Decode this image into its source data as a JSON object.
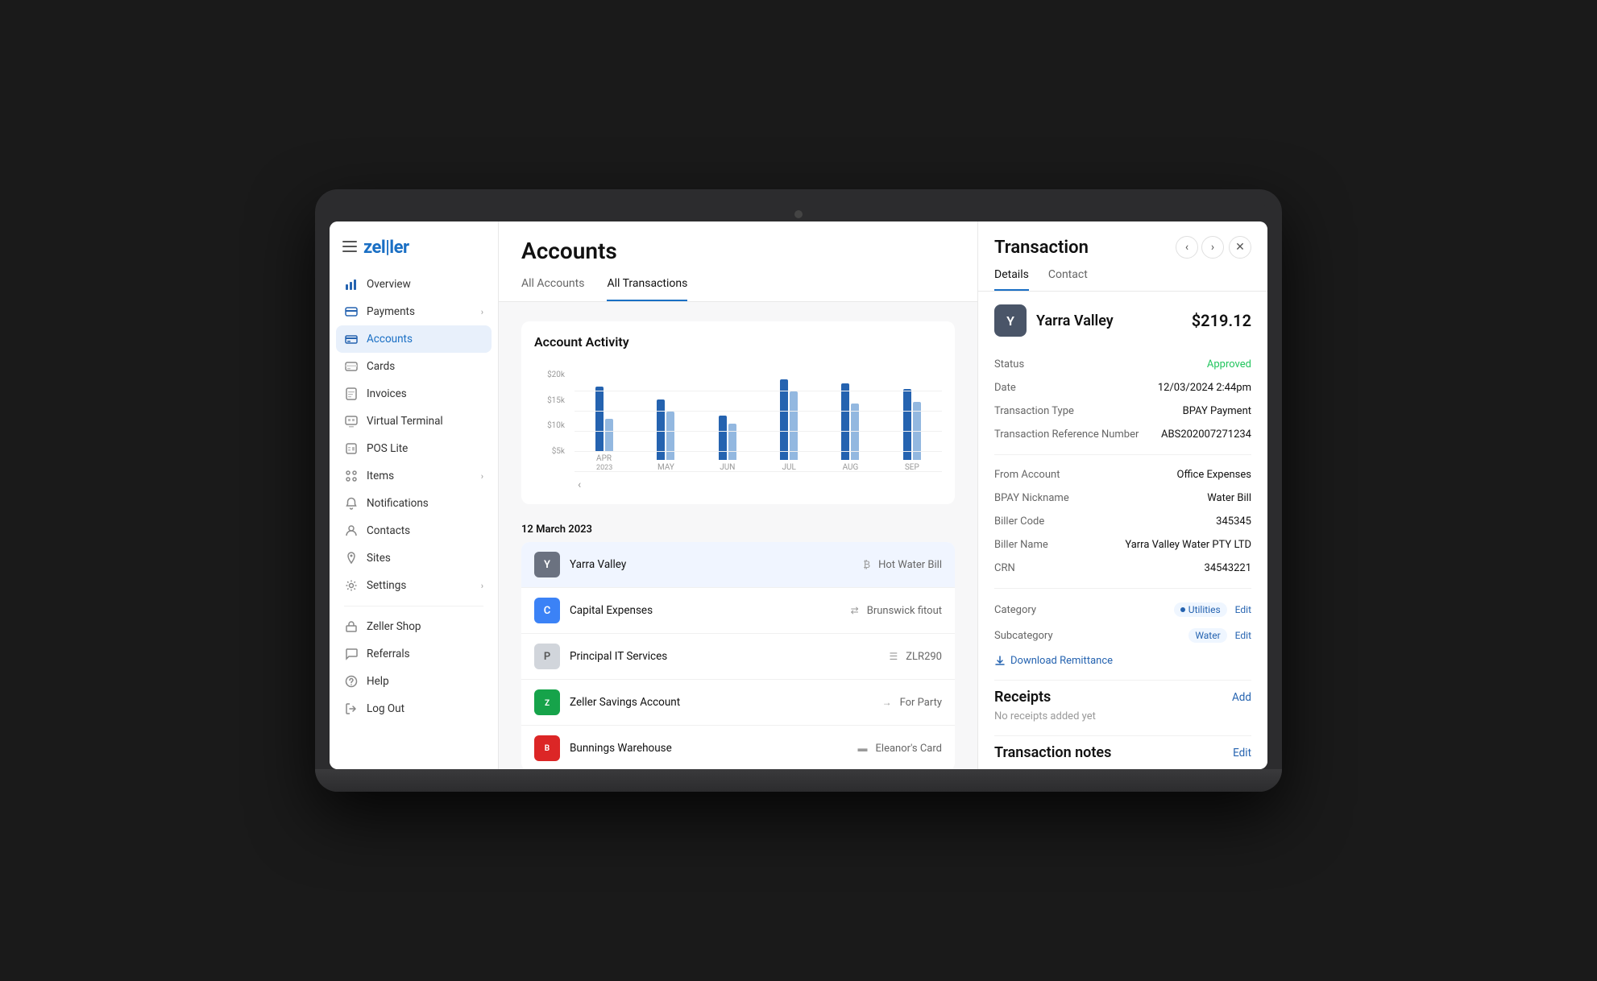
{
  "app": {
    "logo": "zeller"
  },
  "sidebar": {
    "menu_icon": "≡",
    "items": [
      {
        "id": "overview",
        "label": "Overview",
        "icon": "bar-chart",
        "active": false,
        "has_chevron": false
      },
      {
        "id": "payments",
        "label": "Payments",
        "icon": "credit-card",
        "active": false,
        "has_chevron": true
      },
      {
        "id": "accounts",
        "label": "Accounts",
        "icon": "bank",
        "active": true,
        "has_chevron": false
      },
      {
        "id": "cards",
        "label": "Cards",
        "icon": "card",
        "active": false,
        "has_chevron": false
      },
      {
        "id": "invoices",
        "label": "Invoices",
        "icon": "invoice",
        "active": false,
        "has_chevron": false
      },
      {
        "id": "virtual-terminal",
        "label": "Virtual Terminal",
        "icon": "terminal",
        "active": false,
        "has_chevron": false
      },
      {
        "id": "pos-lite",
        "label": "POS Lite",
        "icon": "pos",
        "active": false,
        "has_chevron": false
      },
      {
        "id": "items",
        "label": "Items",
        "icon": "items",
        "active": false,
        "has_chevron": true
      },
      {
        "id": "notifications",
        "label": "Notifications",
        "icon": "bell",
        "active": false,
        "has_chevron": false
      },
      {
        "id": "contacts",
        "label": "Contacts",
        "icon": "person",
        "active": false,
        "has_chevron": false
      },
      {
        "id": "sites",
        "label": "Sites",
        "icon": "location",
        "active": false,
        "has_chevron": false
      },
      {
        "id": "settings",
        "label": "Settings",
        "icon": "gear",
        "active": false,
        "has_chevron": true
      }
    ],
    "bottom_items": [
      {
        "id": "zeller-shop",
        "label": "Zeller Shop",
        "icon": "shop"
      },
      {
        "id": "referrals",
        "label": "Referrals",
        "icon": "chat"
      },
      {
        "id": "help",
        "label": "Help",
        "icon": "help"
      },
      {
        "id": "logout",
        "label": "Log Out",
        "icon": "logout"
      }
    ]
  },
  "main": {
    "title": "Accounts",
    "tabs": [
      {
        "id": "all-accounts",
        "label": "All Accounts",
        "active": false
      },
      {
        "id": "all-transactions",
        "label": "All Transactions",
        "active": true
      }
    ],
    "chart": {
      "title": "Account Activity",
      "y_labels": [
        "$20k",
        "$15k",
        "$10k",
        "$5k",
        ""
      ],
      "months": [
        {
          "label": "APR\n2023",
          "bar1": 80,
          "bar2": 40
        },
        {
          "label": "MAY",
          "bar1": 75,
          "bar2": 60
        },
        {
          "label": "JUN",
          "bar1": 55,
          "bar2": 45
        },
        {
          "label": "JUL",
          "bar1": 100,
          "bar2": 85
        },
        {
          "label": "AUG",
          "bar1": 95,
          "bar2": 70
        },
        {
          "label": "SEP",
          "bar1": 88,
          "bar2": 72
        }
      ]
    },
    "date_label": "12 March 2023",
    "transactions": [
      {
        "id": "tx1",
        "name": "Yarra Valley",
        "avatar_letter": "Y",
        "avatar_bg": "#6b7280",
        "type_icon": "₿",
        "description": "Hot Water Bill",
        "selected": true
      },
      {
        "id": "tx2",
        "name": "Capital Expenses",
        "avatar_letter": "C",
        "avatar_bg": "#3b82f6",
        "type_icon": "⇄",
        "description": "Brunswick fitout",
        "selected": false
      },
      {
        "id": "tx3",
        "name": "Principal IT Services",
        "avatar_letter": "P",
        "avatar_bg": "#d1d5db",
        "avatar_color": "#555",
        "type_icon": "☰",
        "description": "ZLR290",
        "selected": false
      },
      {
        "id": "tx4",
        "name": "Zeller Savings Account",
        "avatar_letter": "Z",
        "avatar_bg": "#16a34a",
        "type_icon": "→",
        "description": "For Party",
        "selected": false
      },
      {
        "id": "tx5",
        "name": "Bunnings Warehouse",
        "avatar_letter": "B",
        "avatar_bg": "#dc2626",
        "type_icon": "▬",
        "description": "Eleanor's Card",
        "selected": false
      }
    ]
  },
  "detail": {
    "title": "Transaction",
    "tabs": [
      {
        "id": "details",
        "label": "Details",
        "active": true
      },
      {
        "id": "contact",
        "label": "Contact",
        "active": false
      }
    ],
    "merchant": {
      "avatar_letter": "Y",
      "avatar_bg": "#4a5568",
      "name": "Yarra Valley",
      "amount": "$219.12"
    },
    "fields": [
      {
        "label": "Status",
        "value": "Approved",
        "type": "approved"
      },
      {
        "label": "Date",
        "value": "12/03/2024 2:44pm",
        "type": "normal"
      },
      {
        "label": "Transaction Type",
        "value": "BPAY Payment",
        "type": "normal"
      },
      {
        "label": "Transaction Reference Number",
        "value": "ABS202007271234",
        "type": "normal"
      }
    ],
    "fields2": [
      {
        "label": "From Account",
        "value": "Office Expenses",
        "type": "normal"
      },
      {
        "label": "BPAY Nickname",
        "value": "Water Bill",
        "type": "normal"
      },
      {
        "label": "Biller Code",
        "value": "345345",
        "type": "normal"
      },
      {
        "label": "Biller Name",
        "value": "Yarra Valley Water PTY LTD",
        "type": "normal"
      },
      {
        "label": "CRN",
        "value": "34543221",
        "type": "normal"
      }
    ],
    "category": {
      "label": "Category",
      "tag": "Utilities",
      "edit_label": "Edit"
    },
    "subcategory": {
      "label": "Subcategory",
      "tag": "Water",
      "edit_label": "Edit"
    },
    "download_remittance_label": "Download Remittance",
    "receipts": {
      "title": "Receipts",
      "add_label": "Add",
      "empty_text": "No receipts added yet"
    },
    "notes": {
      "title": "Transaction notes",
      "edit_label": "Edit"
    }
  }
}
